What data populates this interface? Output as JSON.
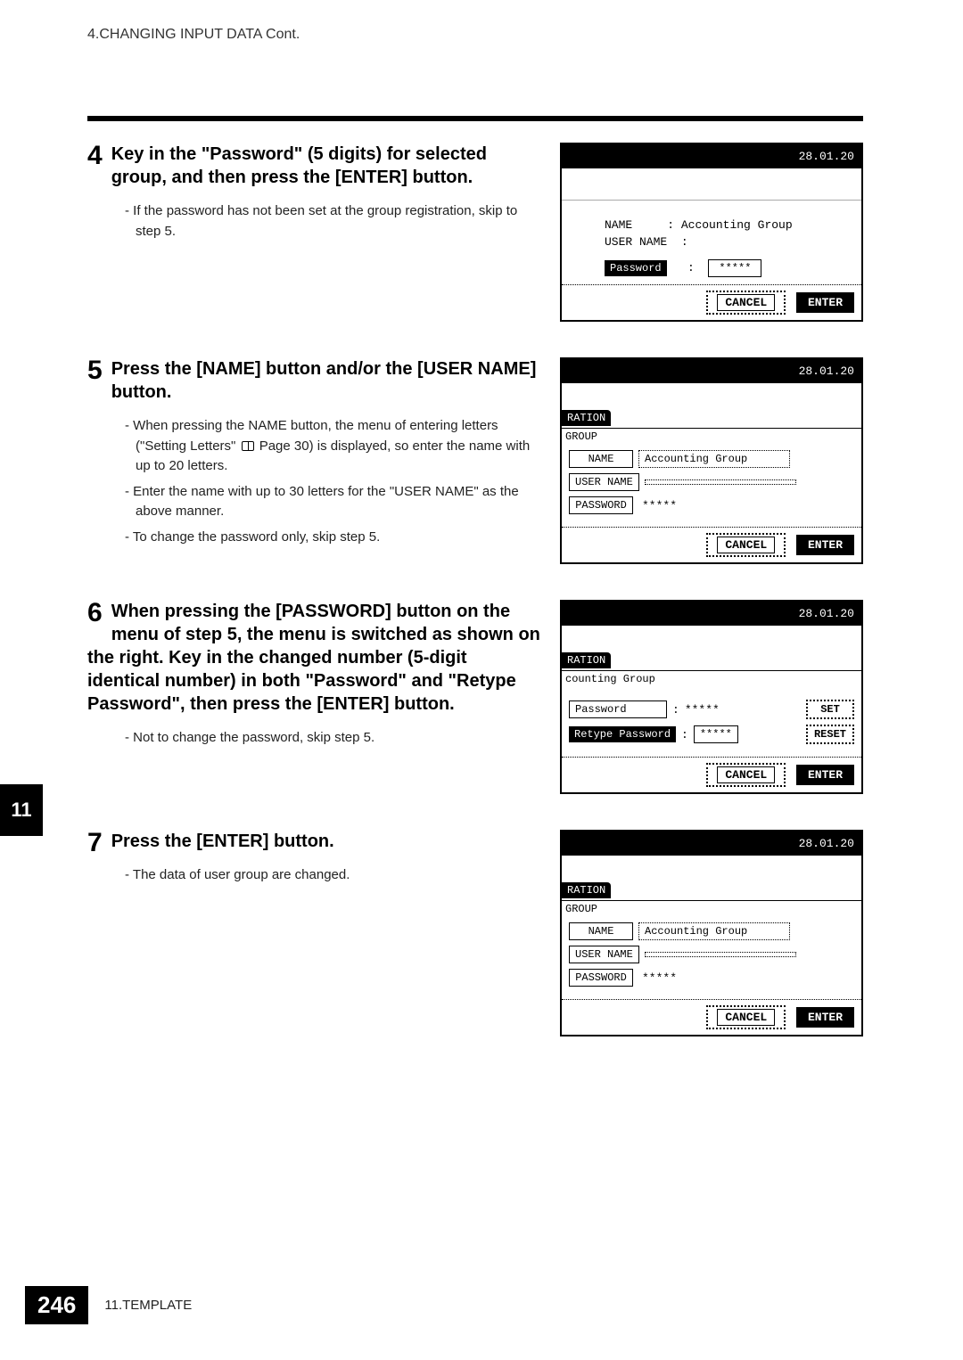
{
  "header": "4.CHANGING INPUT DATA Cont.",
  "chapter_tab": "11",
  "footer": {
    "page": "246",
    "section": "11.TEMPLATE"
  },
  "step4": {
    "num": "4",
    "title": "Key in the \"Password\" (5 digits) for selected group, and then press the [ENTER] button.",
    "bullets": [
      "If the password has not been set at the group registration, skip to step 5."
    ]
  },
  "step5": {
    "num": "5",
    "title": "Press the [NAME] button and/or the [USER NAME] button.",
    "bullets": [
      "When pressing the NAME button, the menu of entering letters (\"Setting Letters\"  Page 30) is displayed, so enter the name with up to 20 letters.",
      "Enter the name with up to 30 letters for the \"USER NAME\" as the above manner.",
      "To change the password only, skip step 5."
    ]
  },
  "step6": {
    "num": "6",
    "title": "When pressing the [PASSWORD] button on the menu of step 5, the menu is switched as shown on the right. Key in the changed number (5-digit identical number) in both \"Password\" and \"Retype Password\", then press the [ENTER] button.",
    "bullets": [
      "Not to change the password, skip step 5."
    ]
  },
  "step7": {
    "num": "7",
    "title": "Press the [ENTER] button.",
    "bullets": [
      "The data of user group are changed."
    ]
  },
  "screen4": {
    "date": "28.01.20",
    "name_label": "NAME",
    "name_value": ": Accounting Group",
    "username_label": "USER NAME",
    "username_value": ":",
    "password_label": "Password",
    "password_value": "*****",
    "cancel": "CANCEL",
    "enter": "ENTER"
  },
  "screen5": {
    "date": "28.01.20",
    "tab": "RATION",
    "sub": "GROUP",
    "name_btn": "NAME",
    "name_val": "Accounting Group",
    "username_btn": "USER NAME",
    "username_val": "",
    "password_btn": "PASSWORD",
    "password_val": "*****",
    "cancel": "CANCEL",
    "enter": "ENTER"
  },
  "screen6": {
    "date": "28.01.20",
    "tab": "RATION",
    "sub": "counting Group",
    "pw_label": "Password",
    "pw_val": "*****",
    "rpw_label": "Retype Password",
    "rpw_val": "*****",
    "set": "SET",
    "reset": "RESET",
    "cancel": "CANCEL",
    "enter": "ENTER"
  },
  "screen7": {
    "date": "28.01.20",
    "tab": "RATION",
    "sub": "GROUP",
    "name_btn": "NAME",
    "name_val": "Accounting Group",
    "username_btn": "USER NAME",
    "username_val": "",
    "password_btn": "PASSWORD",
    "password_val": "*****",
    "cancel": "CANCEL",
    "enter": "ENTER"
  }
}
